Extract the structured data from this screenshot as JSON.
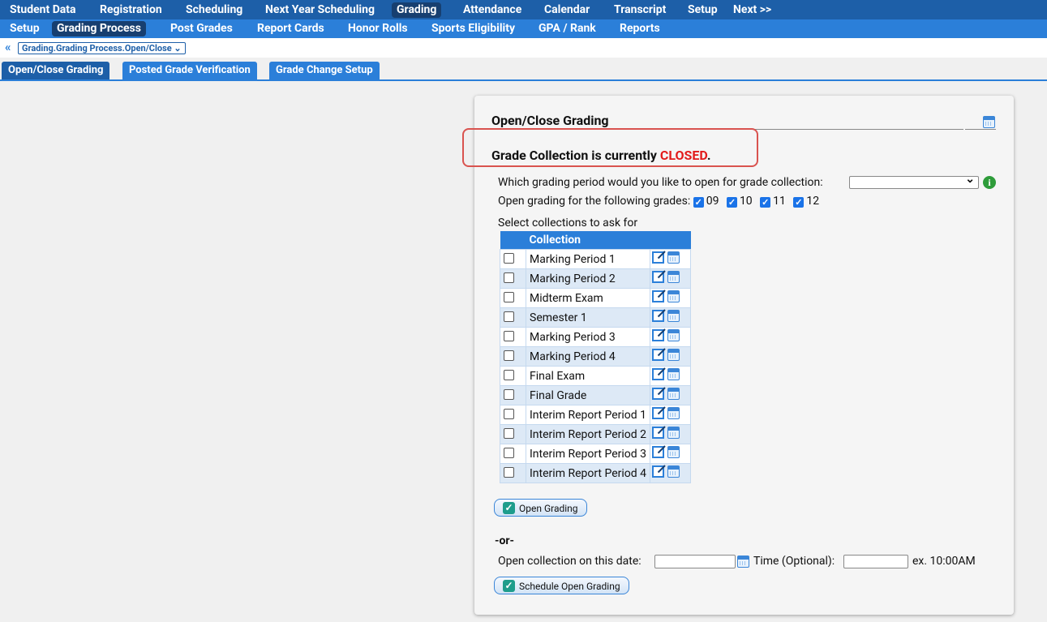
{
  "top_nav": [
    "Student Data",
    "Registration",
    "Scheduling",
    "Next Year Scheduling",
    "Grading",
    "Attendance",
    "Calendar",
    "Transcript",
    "Setup",
    "Next >>"
  ],
  "sub_nav": [
    "Setup",
    "Grading Process",
    "Post Grades",
    "Report Cards",
    "Honor Rolls",
    "Sports Eligibility",
    "GPA / Rank",
    "Reports"
  ],
  "breadcrumb": {
    "arrows": "«",
    "value": "Grading.Grading Process.Open/Close ⌄"
  },
  "tabs": [
    "Open/Close Grading",
    "Posted Grade Verification",
    "Grade Change Setup"
  ],
  "panel": {
    "title": "Open/Close Grading",
    "status_prefix": "Grade Collection is currently ",
    "status_word": "CLOSED",
    "status_suffix": ".",
    "period_question": "Which grading period would you like to open for grade collection:",
    "grades_label": "Open grading for the following grades:",
    "grades": [
      "09",
      "10",
      "11",
      "12"
    ],
    "select_label": "Select collections to ask for",
    "collection_header": "Collection",
    "collections": [
      "Marking Period 1",
      "Marking Period 2",
      "Midterm Exam",
      "Semester 1",
      "Marking Period 3",
      "Marking Period 4",
      "Final Exam",
      "Final Grade",
      "Interim Report Period 1",
      "Interim Report Period 2",
      "Interim Report Period 3",
      "Interim Report Period 4"
    ],
    "open_button": "Open Grading",
    "or_label": "-or-",
    "date_label": "Open collection on this date:",
    "time_label": "Time (Optional):",
    "time_example": "ex. 10:00AM",
    "schedule_button": "Schedule Open Grading"
  }
}
